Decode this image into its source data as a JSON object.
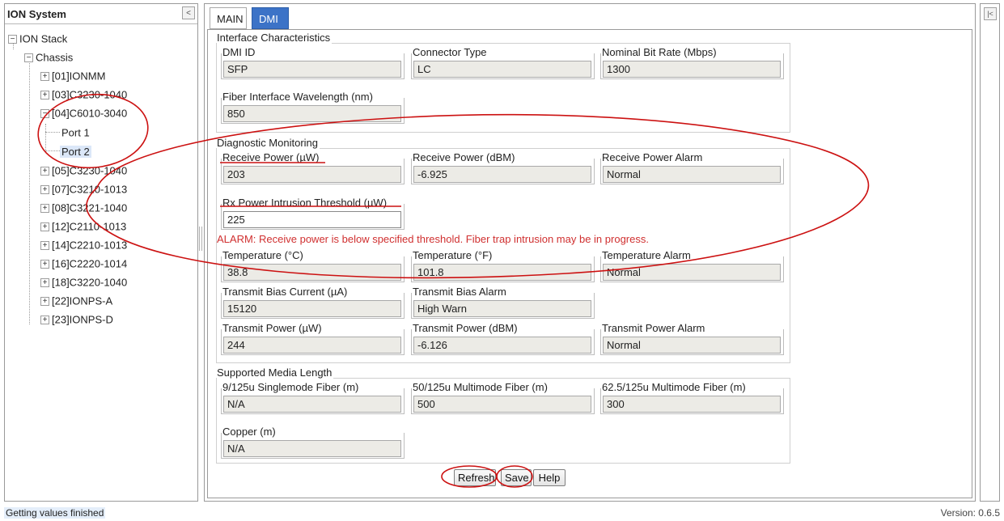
{
  "left_panel": {
    "title": "ION System",
    "collapse_glyph": "<",
    "tree": {
      "root": "ION Stack",
      "chassis": "Chassis",
      "modules": [
        "[01]IONMM",
        "[03]C3230-1040",
        "[04]C6010-3040",
        "[05]C3230-1040",
        "[07]C3210-1013",
        "[08]C3221-1040",
        "[12]C2110-1013",
        "[14]C2210-1013",
        "[16]C2220-1014",
        "[18]C3220-1040",
        "[22]IONPS-A",
        "[23]IONPS-D"
      ],
      "ports": [
        "Port 1",
        "Port 2"
      ],
      "selected": "Port 2"
    }
  },
  "tabs": [
    {
      "label": "MAIN",
      "active": false
    },
    {
      "label": "DMI",
      "active": true
    }
  ],
  "sections": {
    "interface": {
      "title": "Interface Characteristics",
      "dmi_id": {
        "label": "DMI ID",
        "value": "SFP"
      },
      "connector_type": {
        "label": "Connector Type",
        "value": "LC"
      },
      "nominal_bit_rate": {
        "label": "Nominal Bit Rate (Mbps)",
        "value": "1300"
      },
      "wavelength": {
        "label": "Fiber Interface Wavelength (nm)",
        "value": "850"
      }
    },
    "diagnostic": {
      "title": "Diagnostic Monitoring",
      "receive_power_uw": {
        "label": "Receive Power (µW)",
        "value": "203"
      },
      "receive_power_dbm": {
        "label": "Receive Power (dBM)",
        "value": "-6.925"
      },
      "receive_power_alarm": {
        "label": "Receive Power Alarm",
        "value": "Normal"
      },
      "rx_threshold": {
        "label": "Rx Power Intrusion Threshold (µW)",
        "value": "225"
      },
      "alarm_message": "ALARM: Receive power is below specified threshold. Fiber trap intrusion may be in progress.",
      "temperature_c": {
        "label": "Temperature (°C)",
        "value": "38.8"
      },
      "temperature_f": {
        "label": "Temperature (°F)",
        "value": "101.8"
      },
      "temperature_alarm": {
        "label": "Temperature Alarm",
        "value": "Normal"
      },
      "bias_current": {
        "label": "Transmit Bias Current (µA)",
        "value": "15120"
      },
      "bias_alarm": {
        "label": "Transmit Bias Alarm",
        "value": "High Warn"
      },
      "tx_power_uw": {
        "label": "Transmit Power (µW)",
        "value": "244"
      },
      "tx_power_dbm": {
        "label": "Transmit Power (dBM)",
        "value": "-6.126"
      },
      "tx_power_alarm": {
        "label": "Transmit Power Alarm",
        "value": "Normal"
      }
    },
    "media": {
      "title": "Supported Media Length",
      "singlemode": {
        "label": "9/125u Singlemode Fiber (m)",
        "value": "N/A"
      },
      "multimode_50": {
        "label": "50/125u Multimode Fiber (m)",
        "value": "500"
      },
      "multimode_62": {
        "label": "62.5/125u Multimode Fiber (m)",
        "value": "300"
      },
      "copper": {
        "label": "Copper (m)",
        "value": "N/A"
      }
    }
  },
  "buttons": {
    "refresh": "Refresh",
    "save": "Save",
    "help": "Help"
  },
  "right_panel": {
    "collapse_glyph": "|<"
  },
  "status": {
    "message": "Getting values finished",
    "version": "Version: 0.6.5"
  },
  "colors": {
    "active_tab": "#3c73c7",
    "alarm_text": "#d03030",
    "annotation": "#cc1111",
    "readonly_field": "#ecebe6"
  }
}
